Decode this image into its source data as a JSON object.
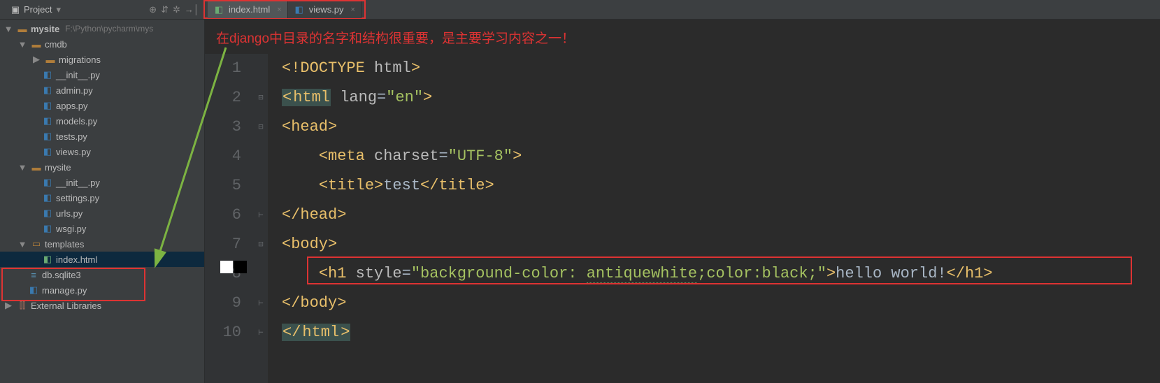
{
  "toolbar": {
    "project_label": "Project",
    "tabs": [
      {
        "label": "index.html",
        "icon": "html-icon"
      },
      {
        "label": "views.py",
        "icon": "py-icon"
      }
    ]
  },
  "tree": {
    "root": {
      "name": "mysite",
      "path": "F:\\Python\\pycharm\\mys"
    },
    "cmdb": "cmdb",
    "migrations": "migrations",
    "files_cmdb": [
      "__init__.py",
      "admin.py",
      "apps.py",
      "models.py",
      "tests.py",
      "views.py"
    ],
    "mysite_pkg": "mysite",
    "files_mysite": [
      "__init__.py",
      "settings.py",
      "urls.py",
      "wsgi.py"
    ],
    "templates": "templates",
    "index_html": "index.html",
    "db": "db.sqlite3",
    "manage": "manage.py",
    "ext_lib": "External Libraries"
  },
  "annotation": "在django中目录的名字和结构很重要，是主要学习内容之一！",
  "code": {
    "l1_doctype": "DOCTYPE",
    "l1_html": "html",
    "l2_html": "html",
    "l2_attr": "lang",
    "l2_val": "\"en\"",
    "l3_head": "head",
    "l4_meta": "meta",
    "l4_attr": "charset",
    "l4_val": "\"UTF-8\"",
    "l5_title": "title",
    "l5_txt": "test",
    "l6_head": "head",
    "l7_body": "body",
    "l8_h1": "h1",
    "l8_attr": "style",
    "l8_valA": "\"background-color: ",
    "l8_valB": "antiquewhite",
    "l8_valC": ";color:black;\"",
    "l8_txt": "hello world!",
    "l9_body": "body",
    "l10_html": "html"
  },
  "line_numbers": [
    "1",
    "2",
    "3",
    "4",
    "5",
    "6",
    "7",
    "8",
    "9",
    "10"
  ]
}
